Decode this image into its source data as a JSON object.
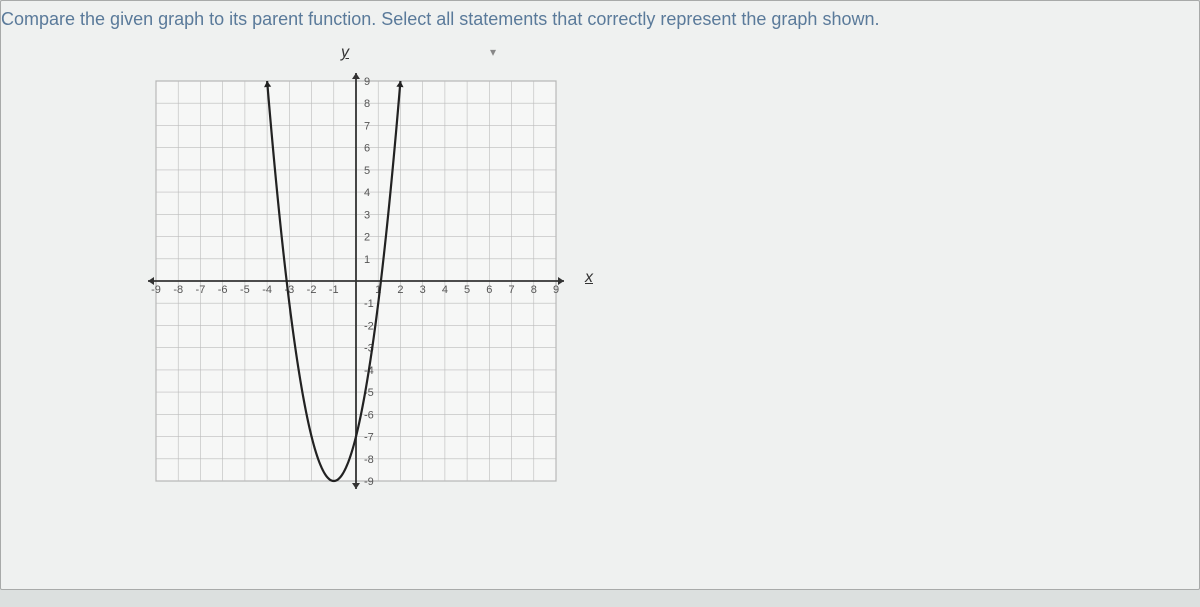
{
  "question": "Compare the given graph to its parent function.  Select all statements that correctly represent the graph shown.",
  "chart_data": {
    "type": "line",
    "title": "",
    "xlabel": "x",
    "ylabel": "y",
    "xlim": [
      -9,
      9
    ],
    "ylim": [
      -9,
      9
    ],
    "x_ticks": [
      -9,
      -8,
      -7,
      -6,
      -5,
      -4,
      -3,
      -2,
      -1,
      1,
      2,
      3,
      4,
      5,
      6,
      7,
      8,
      9
    ],
    "y_ticks": [
      -9,
      -8,
      -7,
      -6,
      -5,
      -4,
      -3,
      -2,
      -1,
      1,
      2,
      3,
      4,
      5,
      6,
      7,
      8,
      9
    ],
    "series": [
      {
        "name": "parabola",
        "description": "upward parabola shifted down 9, y = x^2 - 9 approx, vertex near (-1, -9)",
        "x": [
          -4,
          -3.5,
          -3,
          -2.5,
          -2,
          -1.5,
          -1,
          -0.5,
          0,
          0.5,
          1,
          1.5,
          2
        ],
        "y": [
          9,
          3.5,
          -1,
          -4.5,
          -7,
          -8.5,
          -9,
          -8.5,
          -7,
          -4.5,
          -1,
          3.5,
          9
        ]
      }
    ]
  }
}
